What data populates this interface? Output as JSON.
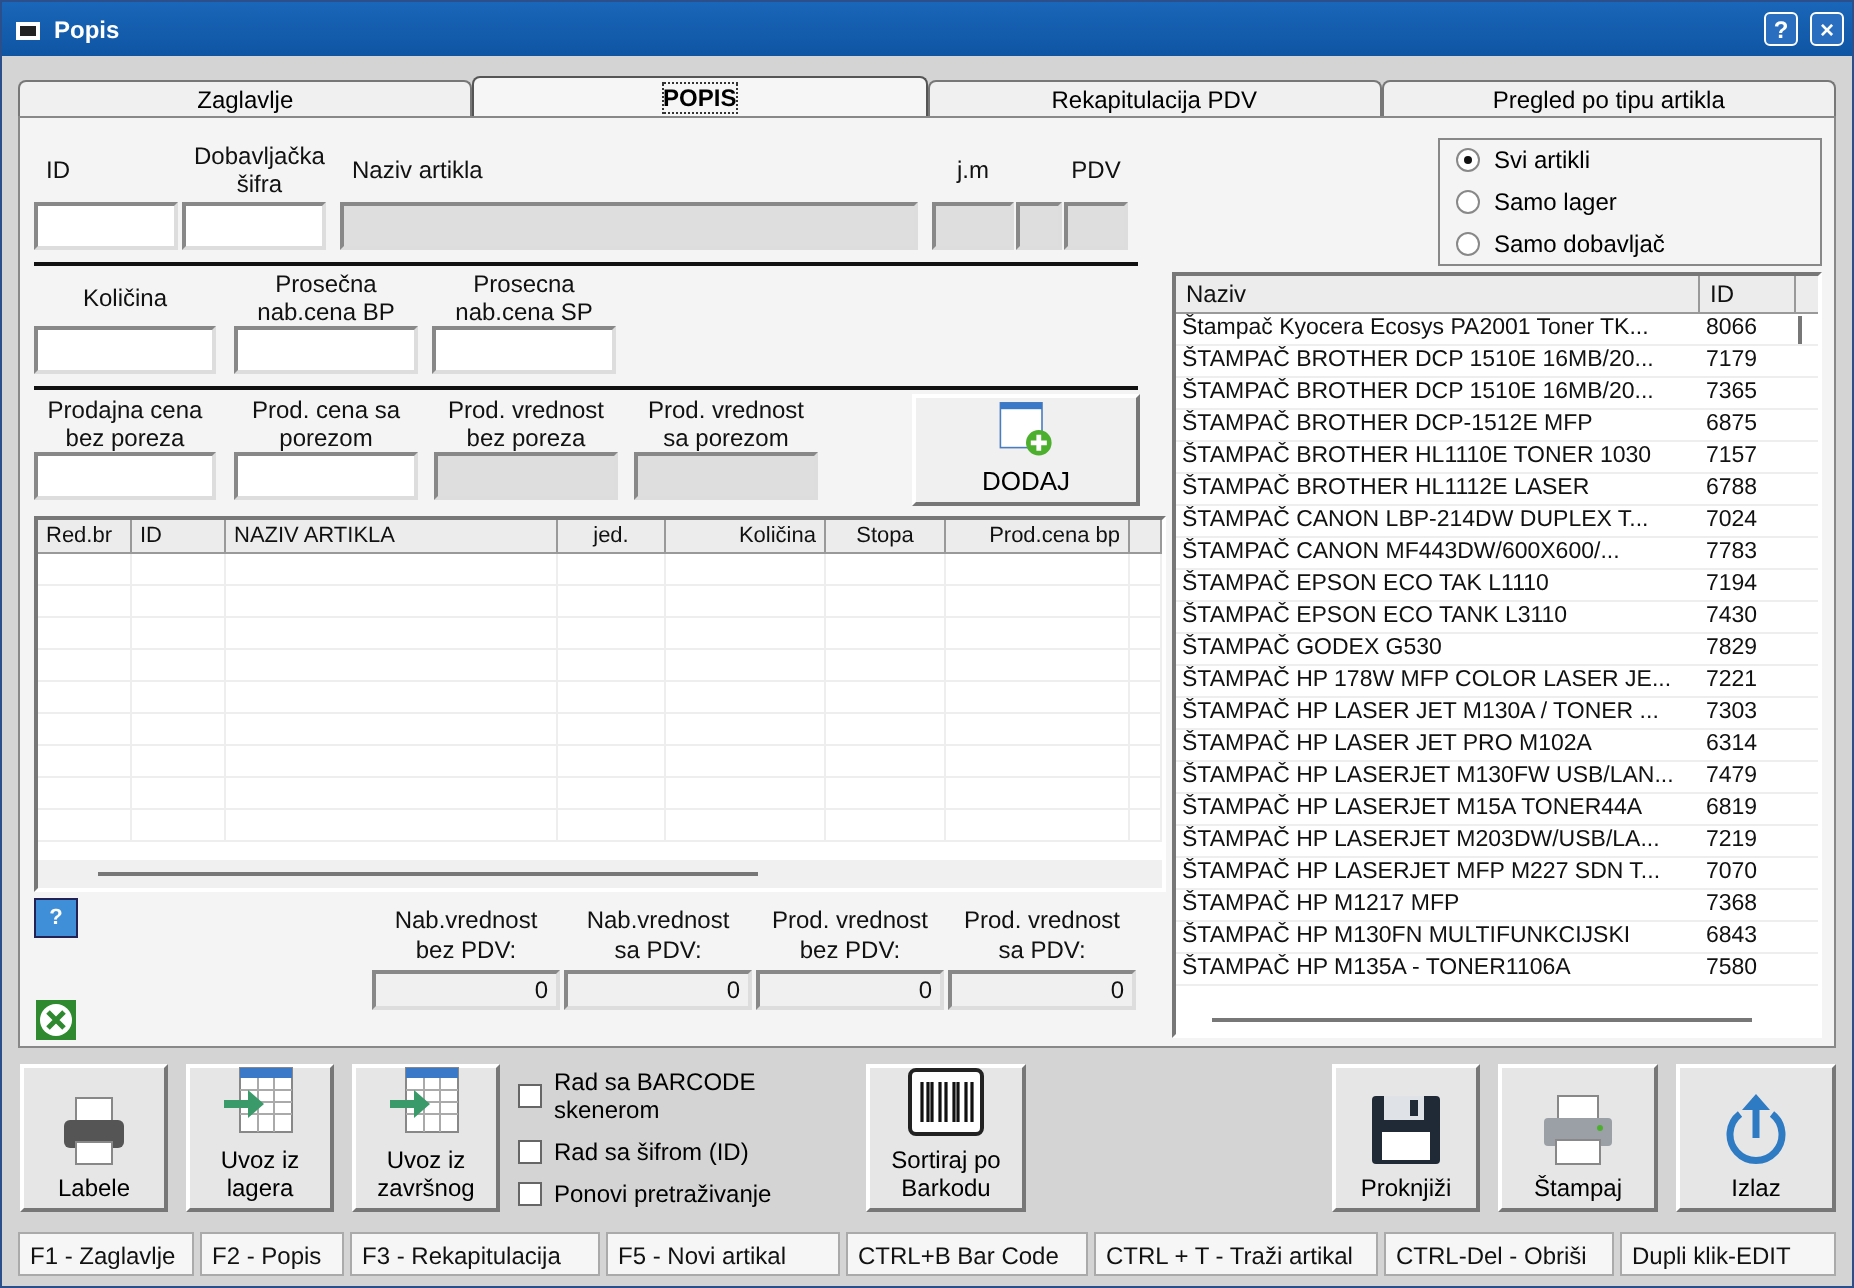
{
  "window": {
    "title": "Popis",
    "help": "?",
    "close": "×"
  },
  "tabs": [
    {
      "label": "Zaglavlje",
      "selected": false
    },
    {
      "label": "POPIS",
      "selected": true
    },
    {
      "label": "Rekapitulacija PDV",
      "selected": false
    },
    {
      "label": "Pregled po tipu artikla",
      "selected": false
    }
  ],
  "article_fields": [
    {
      "label": "ID",
      "disabled": false
    },
    {
      "label": "Dobavljačka\nšifra",
      "disabled": false
    },
    {
      "label": "Naziv artikla",
      "disabled": true
    },
    {
      "label": "j.m",
      "disabled": true
    },
    {
      "disabled": true
    },
    {
      "label": "PDV",
      "disabled": true
    }
  ],
  "quantity_fields": [
    {
      "label": "Količina",
      "disabled": false
    },
    {
      "label": "Prosečna\nnab.cena BP",
      "disabled": false
    },
    {
      "label": "Prosecna\nnab.cena SP",
      "disabled": false
    }
  ],
  "price_fields": [
    {
      "label": "Prodajna cena\nbez poreza",
      "disabled": false
    },
    {
      "label": "Prod. cena sa\nporezom",
      "disabled": false
    },
    {
      "label": "Prod. vrednost\nbez poreza",
      "disabled": true
    },
    {
      "label": "Prod. vrednost\nsa porezom",
      "disabled": true
    }
  ],
  "add_button": {
    "label": "DODAJ",
    "kind": "add"
  },
  "items_table": {
    "columns": [
      "Red.br",
      "ID",
      "NAZIV ARTIKLA",
      "jed.",
      "Količina",
      "Stopa",
      "Prod.cena bp"
    ]
  },
  "help_button": "?",
  "totals": [
    {
      "label": "Nab.vrednost\nbez PDV:",
      "value": "0"
    },
    {
      "label": "Nab.vrednost\nsa PDV:",
      "value": "0"
    },
    {
      "label": "Prod. vrednost\nbez PDV:",
      "value": "0"
    },
    {
      "label": "Prod. vrednost\nsa PDV:",
      "value": "0"
    }
  ],
  "filter": [
    {
      "label": "Svi artikli",
      "selected": true
    },
    {
      "label": "Samo lager",
      "selected": false
    },
    {
      "label": "Samo dobavljač",
      "selected": false
    }
  ],
  "article_list": {
    "columns": [
      "Naziv",
      "ID"
    ],
    "rows": [
      [
        "Štampač Kyocera Ecosys PA2001 Toner TK...",
        "8066"
      ],
      [
        "ŠTAMPAČ BROTHER DCP 1510E 16MB/20...",
        "7179"
      ],
      [
        "ŠTAMPAČ BROTHER DCP 1510E 16MB/20...",
        "7365"
      ],
      [
        "ŠTAMPAČ BROTHER DCP-1512E MFP",
        "6875"
      ],
      [
        "ŠTAMPAČ BROTHER HL1110E TONER 1030",
        "7157"
      ],
      [
        "ŠTAMPAČ BROTHER HL1112E LASER",
        "6788"
      ],
      [
        "ŠTAMPAČ CANON LBP-214DW DUPLEX T...",
        "7024"
      ],
      [
        "ŠTAMPAČ CANON MF443DW/600X600/...",
        "7783"
      ],
      [
        "ŠTAMPAČ EPSON ECO TAK L1110",
        "7194"
      ],
      [
        "ŠTAMPAČ EPSON ECO TANK L3110",
        "7430"
      ],
      [
        "ŠTAMPAČ GODEX G530",
        "7829"
      ],
      [
        "ŠTAMPAČ HP 178W MFP COLOR LASER JE...",
        "7221"
      ],
      [
        "ŠTAMPAČ HP LASER JET M130A / TONER ...",
        "7303"
      ],
      [
        "ŠTAMPAČ HP LASER JET PRO M102A",
        "6314"
      ],
      [
        "ŠTAMPAČ HP LASERJET M130FW USB/LAN...",
        "7479"
      ],
      [
        "ŠTAMPAČ HP LASERJET M15A  TONER44A",
        "6819"
      ],
      [
        "ŠTAMPAČ HP LASERJET M203DW/USB/LA...",
        "7219"
      ],
      [
        "ŠTAMPAČ HP LASERJET MFP M227 SDN T...",
        "7070"
      ],
      [
        "ŠTAMPAČ HP M1217 MFP",
        "7368"
      ],
      [
        "ŠTAMPAČ HP M130FN MULTIFUNKCIJSKI",
        "6843"
      ],
      [
        "ŠTAMPAČ HP M135A - TONER1106A",
        "7580"
      ]
    ]
  },
  "toolbar": [
    {
      "label": "Labele",
      "kind": "printer-small"
    },
    {
      "label": "Uvoz iz\nlagera",
      "kind": "import"
    },
    {
      "label": "Uvoz iz\nzavršnog",
      "kind": "import"
    },
    {
      "kind": "options",
      "options": [
        {
          "label": "Rad sa BARCODE\nskenerom",
          "checked": false
        },
        {
          "label": "Rad sa šifrom (ID)",
          "checked": false
        },
        {
          "label": "Ponovi pretraživanje",
          "checked": false
        }
      ]
    },
    {
      "label": "Sortiraj po\nBarkodu",
      "kind": "barcode"
    },
    {
      "kind": "spacer"
    },
    {
      "label": "Proknjiži",
      "kind": "save"
    },
    {
      "label": "Štampaj",
      "kind": "printer"
    },
    {
      "label": "Izlaz",
      "kind": "exit"
    }
  ],
  "status_bar": [
    "F1 - Zaglavlje",
    "F2 - Popis",
    "F3 - Rekapitulacija",
    "F5 - Novi artikal",
    "CTRL+B Bar Code",
    "CTRL + T - Traži artikal",
    "CTRL-Del - Obriši",
    "Dupli klik-EDIT"
  ]
}
